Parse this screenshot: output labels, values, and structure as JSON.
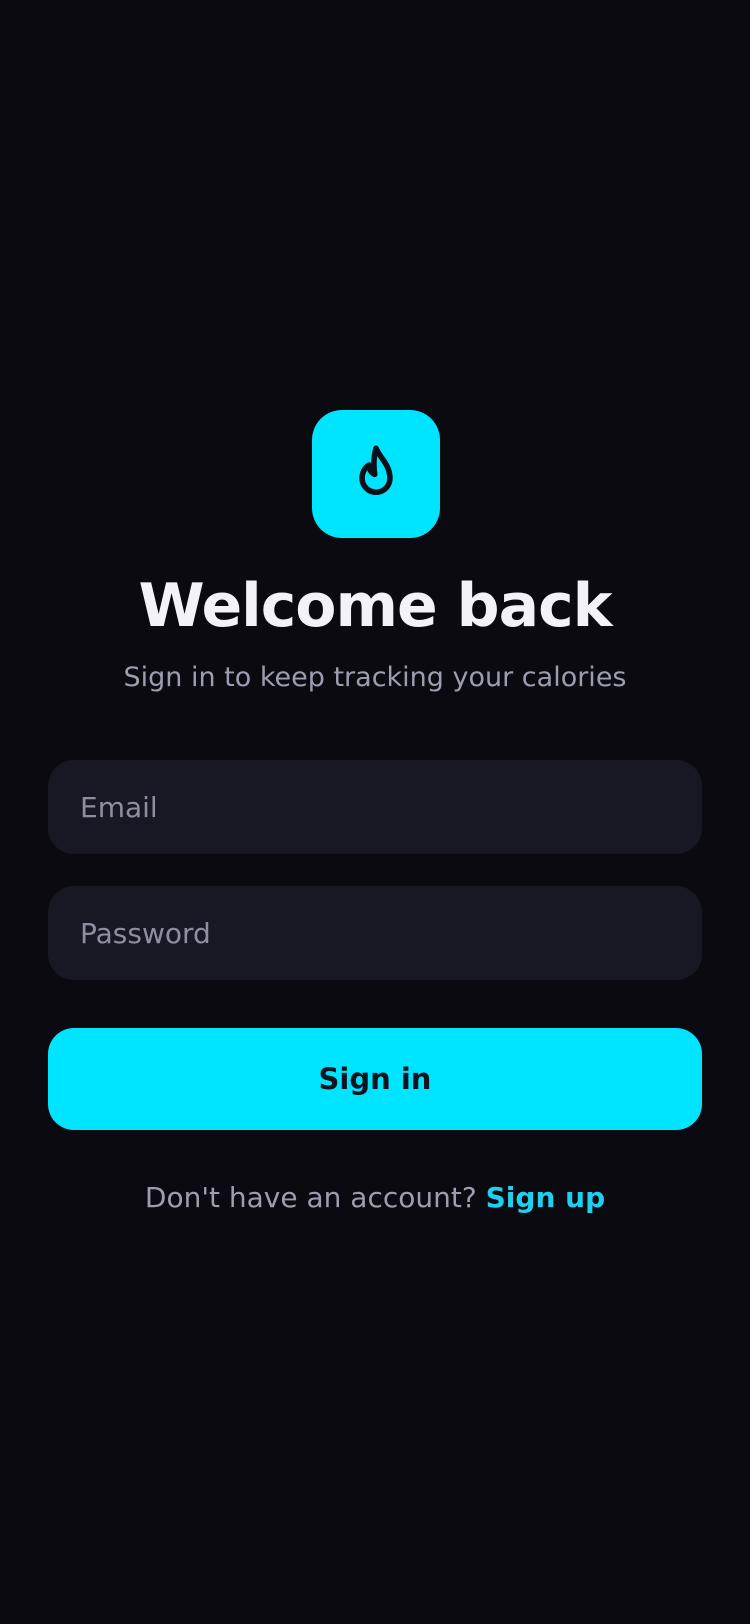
{
  "logo": {
    "icon": "flame-icon",
    "background": "#00e5ff"
  },
  "header": {
    "title": "Welcome back",
    "subtitle": "Sign in to keep tracking your calories"
  },
  "form": {
    "email": {
      "value": "",
      "placeholder": "Email"
    },
    "password": {
      "value": "",
      "placeholder": "Password"
    },
    "submit_label": "Sign in"
  },
  "footer": {
    "prompt": "Don't have an account?",
    "link_label": "Sign up"
  },
  "colors": {
    "background": "#0a0a10",
    "accent": "#00e5ff",
    "field_background": "#181824",
    "link": "#1fd0ee"
  }
}
